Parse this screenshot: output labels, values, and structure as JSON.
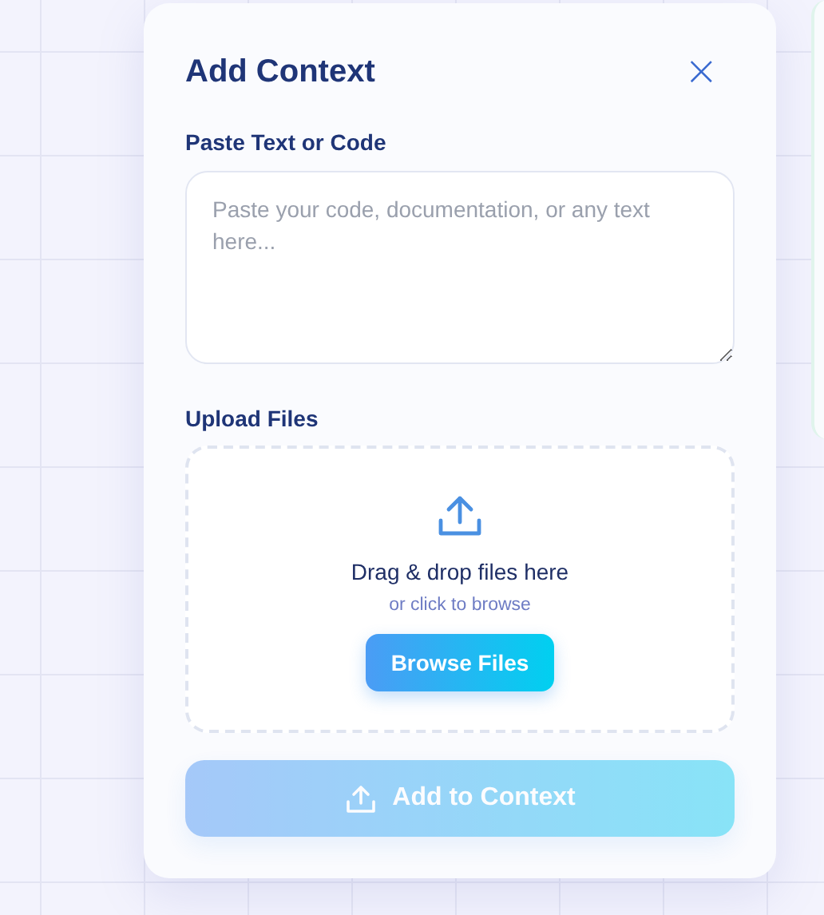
{
  "dialog": {
    "title": "Add Context",
    "close_icon": "×"
  },
  "text_section": {
    "label": "Paste Text or Code",
    "placeholder": "Paste your code, documentation, or any text here..."
  },
  "upload_section": {
    "label": "Upload Files",
    "drop_text": "Drag & drop files here",
    "hint": "or click to browse",
    "browse_button": "Browse Files"
  },
  "submit": {
    "label": "Add to Context",
    "disabled": true
  }
}
